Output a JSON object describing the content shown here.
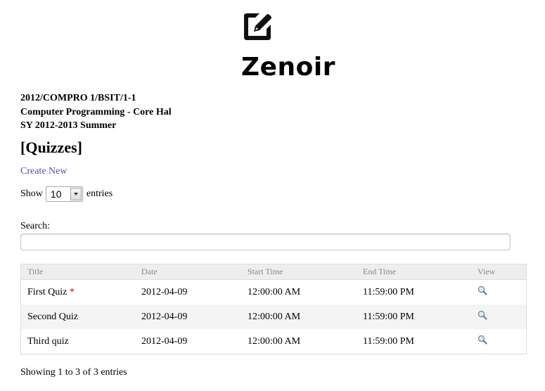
{
  "brand": {
    "name": "Zenoir",
    "logo_icon": "edit-square-icon"
  },
  "course": {
    "code": "2012/COMPRO 1/BSIT/1-1",
    "name": "Computer Programming - Core Hal",
    "term": "SY 2012-2013 Summer"
  },
  "page": {
    "title": "[Quizzes]",
    "create_link": "Create New"
  },
  "length_menu": {
    "prefix": "Show",
    "value": "10",
    "suffix": "entries"
  },
  "search": {
    "label": "Search:",
    "value": ""
  },
  "table": {
    "columns": [
      "Title",
      "Date",
      "Start Time",
      "End Time",
      "View"
    ],
    "rows": [
      {
        "title": "First Quiz",
        "marker": "*",
        "date": "2012-04-09",
        "start": "12:00:00 AM",
        "end": "11:59:00 PM",
        "view_icon": "magnifier-icon"
      },
      {
        "title": "Second Quiz",
        "marker": "",
        "date": "2012-04-09",
        "start": "12:00:00 AM",
        "end": "11:59:00 PM",
        "view_icon": "magnifier-icon"
      },
      {
        "title": "Third quiz",
        "marker": "",
        "date": "2012-04-09",
        "start": "12:00:00 AM",
        "end": "11:59:00 PM",
        "view_icon": "magnifier-icon"
      }
    ]
  },
  "info": "Showing 1 to 3 of 3 entries",
  "colors": {
    "link": "#5a4fa8",
    "required_marker": "#cc0000",
    "header_bg": "#eeeeee",
    "stripe_bg": "#f4f4f4"
  }
}
